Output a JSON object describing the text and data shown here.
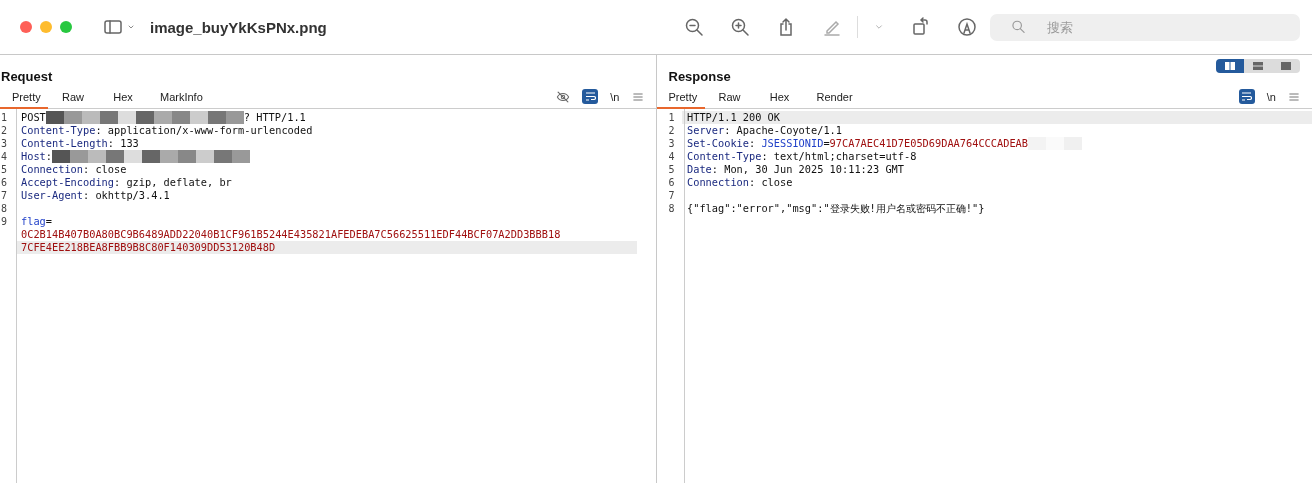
{
  "window": {
    "title": "image_buyYkKsPNx.png",
    "search": {
      "placeholder": "搜索"
    }
  },
  "layout_toggle": [
    {
      "kind": "columns",
      "selected": true
    },
    {
      "kind": "rows",
      "selected": false
    },
    {
      "kind": "single",
      "selected": false
    }
  ],
  "panels": [
    {
      "title": "Request",
      "tabs": [
        {
          "label": "Pretty",
          "selected": true
        },
        {
          "label": "Raw",
          "selected": false
        },
        {
          "label": "Hex",
          "selected": false
        },
        {
          "label": "MarkInfo",
          "selected": false
        }
      ],
      "tools": [
        {
          "kind": "hide"
        },
        {
          "kind": "wrap",
          "selected": true
        },
        {
          "kind": "newline",
          "label": "\\n"
        },
        {
          "kind": "menu"
        }
      ],
      "lines": [
        {
          "number": "1",
          "highlighted": false,
          "segments": [
            {
              "kind": "plain",
              "text": "POST"
            },
            {
              "kind": "mosaic"
            },
            {
              "kind": "plain",
              "text": "? HTTP/1.1"
            }
          ]
        },
        {
          "number": "2",
          "highlighted": false,
          "segments": [
            {
              "kind": "key",
              "text": "Content-Type"
            },
            {
              "kind": "plain",
              "text": ": application/x-www-form-urlencoded"
            }
          ]
        },
        {
          "number": "3",
          "highlighted": false,
          "segments": [
            {
              "kind": "key",
              "text": "Content-Length"
            },
            {
              "kind": "plain",
              "text": ": 133"
            }
          ]
        },
        {
          "number": "4",
          "highlighted": false,
          "segments": [
            {
              "kind": "key",
              "text": "Host"
            },
            {
              "kind": "plain",
              "text": ":"
            },
            {
              "kind": "mosaic"
            }
          ]
        },
        {
          "number": "5",
          "highlighted": false,
          "segments": [
            {
              "kind": "key",
              "text": "Connection"
            },
            {
              "kind": "plain",
              "text": ": close"
            }
          ]
        },
        {
          "number": "6",
          "highlighted": false,
          "segments": [
            {
              "kind": "key",
              "text": "Accept-Encoding"
            },
            {
              "kind": "plain",
              "text": ": gzip, deflate, br"
            }
          ]
        },
        {
          "number": "7",
          "highlighted": false,
          "segments": [
            {
              "kind": "key",
              "text": "User-Agent"
            },
            {
              "kind": "plain",
              "text": ": okhttp/3.4.1"
            }
          ]
        },
        {
          "number": "8",
          "highlighted": false
        },
        {
          "number": "9",
          "highlighted": false,
          "segments": [
            {
              "kind": "param",
              "text": "flag"
            },
            {
              "kind": "plain",
              "text": "="
            }
          ]
        },
        {
          "highlighted": false,
          "segments": [
            {
              "kind": "value",
              "text": "0C2B14B407B0A80BC9B6489ADD22040B1CF961B5244E435821AFEDEBA7C56625511EDF44BCF07A2DD3BBB18"
            }
          ]
        },
        {
          "highlighted": true,
          "segments": [
            {
              "kind": "value",
              "text": "7CFE4EE218BEA8FBB9B8C80F140309DD53120B48D"
            }
          ]
        }
      ]
    },
    {
      "title": "Response",
      "tabs": [
        {
          "label": "Pretty",
          "selected": true
        },
        {
          "label": "Raw",
          "selected": false
        },
        {
          "label": "Hex",
          "selected": false
        },
        {
          "label": "Render",
          "selected": false
        }
      ],
      "tools": [
        {
          "kind": "wrap",
          "selected": true
        },
        {
          "kind": "newline",
          "label": "\\n"
        },
        {
          "kind": "menu"
        }
      ],
      "lines": [
        {
          "number": "1",
          "highlighted": true,
          "segments": [
            {
              "kind": "plain",
              "text": "HTTP/1.1 200 OK"
            }
          ]
        },
        {
          "number": "2",
          "highlighted": false,
          "segments": [
            {
              "kind": "key",
              "text": "Server"
            },
            {
              "kind": "plain",
              "text": ": Apache-Coyote/1.1"
            }
          ]
        },
        {
          "number": "3",
          "highlighted": false,
          "segments": [
            {
              "kind": "key",
              "text": "Set-Cookie"
            },
            {
              "kind": "plain",
              "text": ": "
            },
            {
              "kind": "param",
              "text": "JSESSIONID"
            },
            {
              "kind": "plain",
              "text": "="
            },
            {
              "kind": "value",
              "text": "97CA7AEC41D7E05D69DAA764CCCADEAB"
            },
            {
              "kind": "mosaic-light"
            }
          ]
        },
        {
          "number": "4",
          "highlighted": false,
          "segments": [
            {
              "kind": "key",
              "text": "Content-Type"
            },
            {
              "kind": "plain",
              "text": ": text/html;charset=utf-8"
            }
          ]
        },
        {
          "number": "5",
          "highlighted": false,
          "segments": [
            {
              "kind": "key",
              "text": "Date"
            },
            {
              "kind": "plain",
              "text": ": Mon, 30 Jun 2025 10:11:23 GMT"
            }
          ]
        },
        {
          "number": "6",
          "highlighted": false,
          "segments": [
            {
              "kind": "key",
              "text": "Connection"
            },
            {
              "kind": "plain",
              "text": ": close"
            }
          ]
        },
        {
          "number": "7",
          "highlighted": false
        },
        {
          "number": "8",
          "highlighted": false,
          "segments": [
            {
              "kind": "plain",
              "text": "{\"flag\":\"error\",\"msg\":\"登录失败!用户名或密码不正确!\"}"
            }
          ]
        }
      ]
    }
  ]
}
